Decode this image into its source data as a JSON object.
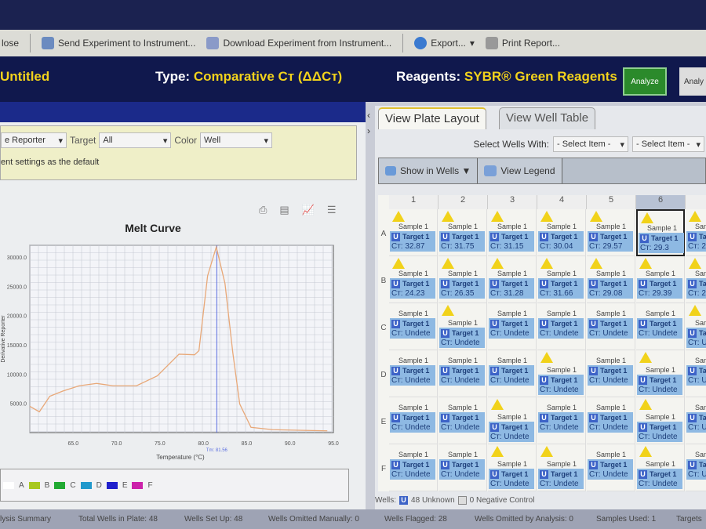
{
  "toolbar": {
    "close": "lose",
    "send": "Send Experiment to Instrument...",
    "download": "Download Experiment from Instrument...",
    "export": "Export...",
    "print": "Print Report..."
  },
  "header": {
    "title": "Untitled",
    "type_label": "Type:",
    "type_value": "Comparative Cт (ΔΔCт)",
    "reagents_label": "Reagents:",
    "reagents_value": "SYBR® Green Reagents",
    "analyze": "Analyze",
    "analyze2": "Analy"
  },
  "filters": {
    "plot_type": "e Reporter",
    "target_label": "Target",
    "target_value": "All",
    "color_label": "Color",
    "color_value": "Well",
    "default_text": "ent settings as the default"
  },
  "chart_data": {
    "type": "line",
    "title": "Melt Curve",
    "xlabel": "Temperature (°C)",
    "ylabel": "Derivative Reporter",
    "xlim": [
      60,
      95
    ],
    "ylim": [
      0,
      32000
    ],
    "xticks": [
      "65.0",
      "70.0",
      "75.0",
      "80.0",
      "85.0",
      "90.0",
      "95.0"
    ],
    "yticks": [
      "5000.0",
      "10000.0",
      "15000.0",
      "20000.0",
      "25000.0",
      "30000.0"
    ],
    "tm_label": "Tm: 81.56",
    "tm": 81.56,
    "series": [
      {
        "name": "Wells",
        "color": "#e8a878",
        "x": [
          60,
          61.1,
          62.3,
          63.8,
          65.7,
          67.7,
          69.6,
          72.3,
          74.7,
          77.2,
          79,
          79.5,
          80.5,
          81.5,
          82.5,
          83.4,
          84.2,
          85.5,
          88,
          91,
          94.3
        ],
        "y": [
          4500,
          3550,
          6200,
          7100,
          8000,
          8400,
          8000,
          8000,
          9700,
          13400,
          13300,
          14000,
          26800,
          31700,
          25500,
          13700,
          4900,
          900,
          500,
          400,
          300
        ]
      }
    ],
    "grid": true
  },
  "legend": {
    "items": [
      {
        "label": "A",
        "color": "#ffffff"
      },
      {
        "label": "B",
        "color": "#a8c820"
      },
      {
        "label": "C",
        "color": "#22aa33"
      },
      {
        "label": "D",
        "color": "#2299cc"
      },
      {
        "label": "E",
        "color": "#2020cc"
      },
      {
        "label": "F",
        "color": "#cc22aa"
      }
    ]
  },
  "right": {
    "tab1": "View Plate Layout",
    "tab2": "View Well Table",
    "select_label": "Select Wells With:",
    "select1": "- Select Item -",
    "select2": "- Select Item -",
    "show_in_wells": "Show in Wells ▼",
    "view_legend": "View Legend"
  },
  "plate": {
    "columns": [
      "1",
      "2",
      "3",
      "4",
      "5",
      "6",
      "7"
    ],
    "rows": [
      "A",
      "B",
      "C",
      "D",
      "E",
      "F"
    ],
    "sample": "Sample 1",
    "target": "Target 1",
    "task": "U",
    "wells": [
      [
        {
          "ct": "Cт: 32.87",
          "f": 1
        },
        {
          "ct": "Cт: 31.75",
          "f": 1
        },
        {
          "ct": "Cт: 31.15",
          "f": 1
        },
        {
          "ct": "Cт: 30.04",
          "f": 1
        },
        {
          "ct": "Cт: 29.57",
          "f": 1
        },
        {
          "ct": "Cт: 29.3",
          "f": 1
        },
        {
          "ct": "Cт: 2",
          "f": 1
        }
      ],
      [
        {
          "ct": "Cт: 24.23",
          "f": 1
        },
        {
          "ct": "Cт: 26.35",
          "f": 1
        },
        {
          "ct": "Cт: 31.28",
          "f": 1
        },
        {
          "ct": "Cт: 31.66",
          "f": 1
        },
        {
          "ct": "Cт: 29.08",
          "f": 1
        },
        {
          "ct": "Cт: 29.39",
          "f": 1
        },
        {
          "ct": "Cт: 29.4",
          "f": 1
        }
      ],
      [
        {
          "ct": "Cт: Undete",
          "f": 0
        },
        {
          "ct": "Cт: Undete",
          "f": 1
        },
        {
          "ct": "Cт: Undete",
          "f": 0
        },
        {
          "ct": "Cт: Undete",
          "f": 0
        },
        {
          "ct": "Cт: Undete",
          "f": 0
        },
        {
          "ct": "Cт: Undete",
          "f": 0
        },
        {
          "ct": "Cт: Undete",
          "f": 1
        }
      ],
      [
        {
          "ct": "Cт: Undete",
          "f": 0
        },
        {
          "ct": "Cт: Undete",
          "f": 0
        },
        {
          "ct": "Cт: Undete",
          "f": 0
        },
        {
          "ct": "Cт: Undete",
          "f": 1
        },
        {
          "ct": "Cт: Undete",
          "f": 0
        },
        {
          "ct": "Cт: Undete",
          "f": 1
        },
        {
          "ct": "Cт: Undete",
          "f": 0
        }
      ],
      [
        {
          "ct": "Cт: Undete",
          "f": 0
        },
        {
          "ct": "Cт: Undete",
          "f": 0
        },
        {
          "ct": "Cт: Undete",
          "f": 1
        },
        {
          "ct": "Cт: Undete",
          "f": 0
        },
        {
          "ct": "Cт: Undete",
          "f": 0
        },
        {
          "ct": "Cт: Undete",
          "f": 1
        },
        {
          "ct": "Cт: Undete",
          "f": 0
        }
      ],
      [
        {
          "ct": "Cт: Undete",
          "f": 0
        },
        {
          "ct": "Cт: Undete",
          "f": 0
        },
        {
          "ct": "Cт: Undete",
          "f": 1
        },
        {
          "ct": "Cт: Undete",
          "f": 1
        },
        {
          "ct": "Cт: Undete",
          "f": 0
        },
        {
          "ct": "Cт: Undete",
          "f": 1
        },
        {
          "ct": "Cт: Undete",
          "f": 0
        }
      ]
    ]
  },
  "wells_bar": {
    "label": "Wells:",
    "unknown": "48 Unknown",
    "negative": "0 Negative Control"
  },
  "status": {
    "summary": "lysis Summary",
    "total": "Total Wells in Plate: 48",
    "setup": "Wells Set Up: 48",
    "omitted_manual": "Wells Omitted Manually: 0",
    "flagged": "Wells Flagged: 28",
    "omitted_analysis": "Wells Omitted by Analysis: 0",
    "samples": "Samples Used: 1",
    "targets": "Targets"
  }
}
